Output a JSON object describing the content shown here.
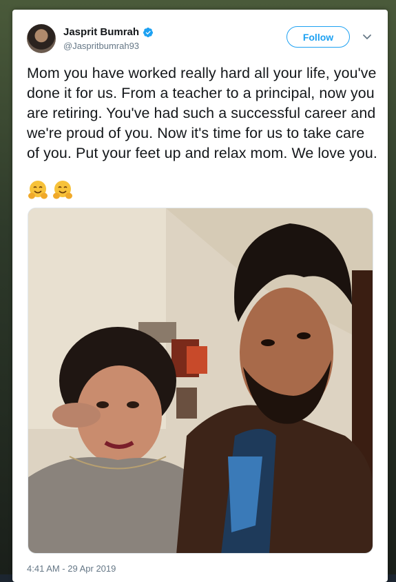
{
  "tweet": {
    "author_name": "Jasprit Bumrah",
    "author_handle": "@Jaspritbumrah93",
    "verified": true,
    "follow_label": "Follow",
    "text": "Mom you have worked really hard all your life, you've done it for us. From a teacher to a principal, now you are retiring. You've had such a successful career and we're proud of you. Now it's time for us to take care of you. Put your feet up and relax mom. We love you.",
    "emojis": [
      "hugging-face-emoji",
      "hugging-face-emoji"
    ],
    "timestamp": "4:41 AM - 29 Apr 2019"
  },
  "colors": {
    "accent": "#1da1f2",
    "text_primary": "#14171a",
    "text_secondary": "#657786"
  },
  "icons": {
    "verified": "verified-badge-icon",
    "menu": "chevron-down-icon"
  }
}
